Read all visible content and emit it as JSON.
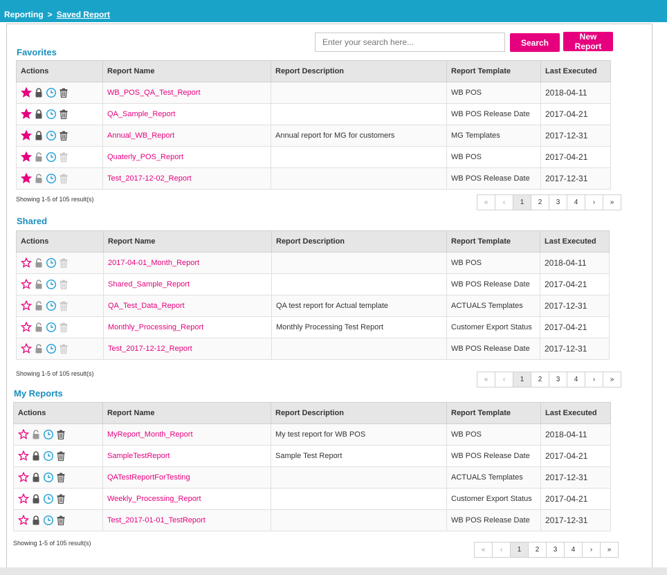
{
  "breadcrumb": {
    "root": "Reporting",
    "separator": ">",
    "current": "Saved Report"
  },
  "search": {
    "placeholder": "Enter your search here...",
    "button": "Search"
  },
  "new_report_button": "New Report",
  "columns": {
    "actions": "Actions",
    "name": "Report Name",
    "description": "Report Description",
    "template": "Report Template",
    "last": "Last Executed"
  },
  "pagination": {
    "first": "«",
    "prev": "‹",
    "pages": [
      "1",
      "2",
      "3",
      "4"
    ],
    "next": "›",
    "last": "»",
    "active": "1"
  },
  "sections": [
    {
      "title": "Favorites",
      "showing": "Showing 1-5 of 105 result(s)",
      "rows": [
        {
          "name": "WB_POS_QA_Test_Report",
          "description": "",
          "template": "WB POS",
          "last": "2018-04-11",
          "starred": true,
          "locked": true,
          "delete_enabled": true
        },
        {
          "name": "QA_Sample_Report",
          "description": "",
          "template": "WB POS  Release Date",
          "last": "2017-04-21",
          "starred": true,
          "locked": true,
          "delete_enabled": true
        },
        {
          "name": "Annual_WB_Report",
          "description": "Annual report for MG  for customers",
          "template": "MG Templates",
          "last": "2017-12-31",
          "starred": true,
          "locked": true,
          "delete_enabled": true
        },
        {
          "name": "Quaterly_POS_Report",
          "description": "",
          "template": "WB POS",
          "last": "2017-04-21",
          "starred": true,
          "locked": false,
          "delete_enabled": false
        },
        {
          "name": "Test_2017-12-02_Report",
          "description": "",
          "template": "WB POS  Release Date",
          "last": "2017-12-31",
          "starred": true,
          "locked": false,
          "delete_enabled": false
        }
      ]
    },
    {
      "title": "Shared",
      "showing": "Showing 1-5 of 105 result(s)",
      "rows": [
        {
          "name": "2017-04-01_Month_Report",
          "description": "",
          "template": "WB POS",
          "last": "2018-04-11",
          "starred": false,
          "locked": false,
          "delete_enabled": false
        },
        {
          "name": "Shared_Sample_Report",
          "description": "",
          "template": "WB POS  Release Date",
          "last": "2017-04-21",
          "starred": false,
          "locked": false,
          "delete_enabled": false
        },
        {
          "name": "QA_Test_Data_Report",
          "description": "QA test report for Actual template",
          "template": "ACTUALS Templates",
          "last": "2017-12-31",
          "starred": false,
          "locked": false,
          "delete_enabled": false
        },
        {
          "name": "Monthly_Processing_Report",
          "description": "Monthly Processing Test  Report",
          "template": "Customer Export Status",
          "last": "2017-04-21",
          "starred": false,
          "locked": false,
          "delete_enabled": false
        },
        {
          "name": "Test_2017-12-12_Report",
          "description": "",
          "template": "WB POS  Release Date",
          "last": "2017-12-31",
          "starred": false,
          "locked": false,
          "delete_enabled": false
        }
      ]
    },
    {
      "title": "My Reports",
      "showing": "Showing 1-5 of 105 result(s)",
      "rows": [
        {
          "name": "MyReport_Month_Report",
          "description": "My test report for WB POS",
          "template": "WB POS",
          "last": "2018-04-11",
          "starred": false,
          "locked": false,
          "delete_enabled": true
        },
        {
          "name": "SampleTestReport",
          "description": "Sample  Test  Report",
          "template": "WB POS  Release Date",
          "last": "2017-04-21",
          "starred": false,
          "locked": true,
          "delete_enabled": true
        },
        {
          "name": "QATestReportForTesting",
          "description": "",
          "template": "ACTUALS Templates",
          "last": "2017-12-31",
          "starred": false,
          "locked": true,
          "delete_enabled": true
        },
        {
          "name": "Weekly_Processing_Report",
          "description": "",
          "template": "Customer Export Status",
          "last": "2017-04-21",
          "starred": false,
          "locked": true,
          "delete_enabled": true
        },
        {
          "name": "Test_2017-01-01_TestReport",
          "description": "",
          "template": "WB POS  Release Date",
          "last": "2017-12-31",
          "starred": false,
          "locked": true,
          "delete_enabled": true
        }
      ]
    }
  ],
  "colors": {
    "accent": "#1aa3c9",
    "brand_pink": "#e6007e",
    "section_title": "#1a8fbf",
    "clock_icon": "#1a9fd6"
  }
}
